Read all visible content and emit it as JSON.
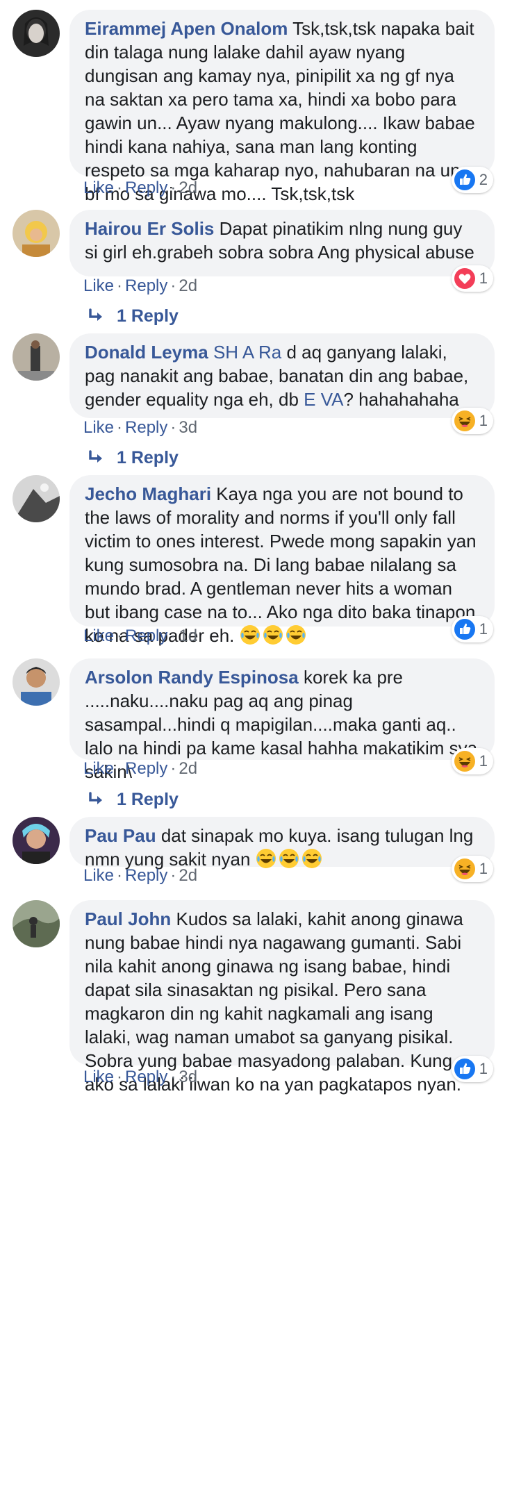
{
  "comments": [
    {
      "author": "Eirammej Apen Onalom",
      "text": " Tsk,tsk,tsk napaka bait din talaga nung lalake dahil ayaw nyang dungisan ang kamay nya, pinipilit xa ng gf nya na saktan xa pero tama xa, hindi xa bobo para gawin un... Ayaw nyang makulong.... Ikaw babae hindi kana nahiya, sana man lang konting respeto sa mga kaharap nyo, nahubaran na ung bf mo sa ginawa mo.... Tsk,tsk,tsk",
      "like": "Like",
      "reply": "Reply",
      "time": "2d",
      "reaction_type": "like",
      "reaction_count": "2"
    },
    {
      "author": "Hairou Er Solis",
      "text": " Dapat pinatikim nlng nung guy si girl eh.grabeh sobra sobra Ang physical abuse",
      "like": "Like",
      "reply": "Reply",
      "time": "2d",
      "reaction_type": "love",
      "reaction_count": "1",
      "replies_label": "1 Reply"
    },
    {
      "author": "Donald Leyma",
      "tag1": "SH A Ra",
      "text1": " d aq ganyang lalaki, pag nanakit ang babae, banatan din ang babae, gender equality nga eh, db ",
      "tag2": "E VA",
      "text2": "? hahahahaha",
      "like": "Like",
      "reply": "Reply",
      "time": "3d",
      "reaction_type": "haha",
      "reaction_count": "1",
      "replies_label": "1 Reply"
    },
    {
      "author": "Jecho Maghari",
      "text": " Kaya nga you are not bound to the laws of morality and norms if you'll only fall victim to ones interest. Pwede mong sapakin yan kung sumosobra na. Di lang babae nilalang sa mundo brad. A gentleman never hits a woman but ibang case na to... Ako nga dito baka tinapon ko na sa pader eh.",
      "emojis": "😂😂😂",
      "like": "Like",
      "reply": "Reply",
      "time": "1d",
      "reaction_type": "like",
      "reaction_count": "1"
    },
    {
      "author": "Arsolon Randy Espinosa",
      "text": " korek ka pre .....naku....naku pag aq ang pinag sasampal...hindi q mapigilan....maka ganti aq.. lalo na hindi pa kame kasal hahha makatikim sya sakin\\",
      "like": "Like",
      "reply": "Reply",
      "time": "2d",
      "reaction_type": "haha",
      "reaction_count": "1",
      "replies_label": "1 Reply"
    },
    {
      "author": "Pau Pau",
      "text": " dat sinapak mo kuya. isang tulugan lng nmn yung sakit nyan ",
      "emojis": "😂😂😂",
      "like": "Like",
      "reply": "Reply",
      "time": "2d",
      "reaction_type": "haha",
      "reaction_count": "1"
    },
    {
      "author": "Paul John",
      "text": " Kudos sa lalaki, kahit anong ginawa nung babae hindi nya nagawang gumanti. Sabi nila kahit anong ginawa ng isang babae, hindi dapat sila sinasaktan ng pisikal. Pero sana magkaron din ng kahit nagkamali ang isang lalaki, wag naman umabot sa ganyang pisikal. Sobra yung babae masyadong palaban. Kung ako sa lalaki iiwan ko na yan pagkatapos nyan.",
      "like": "Like",
      "reply": "Reply",
      "time": "3d",
      "reaction_type": "like",
      "reaction_count": "1"
    }
  ],
  "colors": {
    "link": "#385898",
    "bubble": "#f2f3f5",
    "meta": "#606770",
    "like_blue": "#1877f2",
    "love_red": "#f33e58",
    "haha_yellow": "#f7b125"
  }
}
